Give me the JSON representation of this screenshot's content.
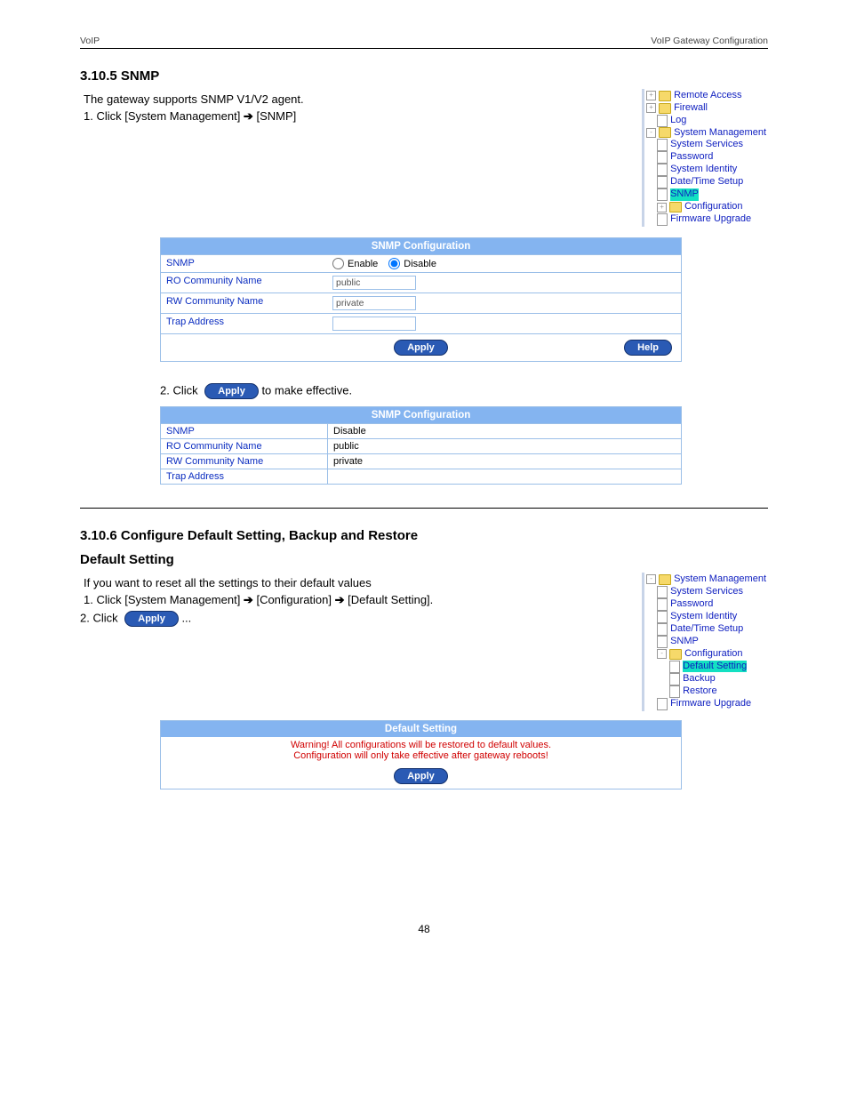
{
  "header": {
    "left": "VoIP",
    "right": "VoIP Gateway Configuration"
  },
  "snmp_section": {
    "title": "3.10.5 SNMP",
    "intro": "The gateway supports SNMP V1/V2 agent.",
    "step1_prefix": "Click [System Management] ",
    "step1_suffix": " [SNMP]",
    "config_title": "SNMP Configuration",
    "rows": {
      "snmp_label": "SNMP",
      "enable_label": "Enable",
      "disable_label": "Disable",
      "ro_label": "RO Community Name",
      "ro_value": "public",
      "rw_label": "RW Community Name",
      "rw_value": "private",
      "trap_label": "Trap Address",
      "trap_value": ""
    },
    "apply_label": "Apply",
    "help_label": "Help",
    "step2_prefix": "Click ",
    "step2_suffix": " to make effective.",
    "result_title": "SNMP Configuration",
    "result_rows": {
      "snmp": "Disable",
      "ro": "public",
      "rw": "private",
      "trap": ""
    },
    "nav": {
      "remote_access": "Remote Access",
      "firewall": "Firewall",
      "log": "Log",
      "sys_mgmt": "System Management",
      "sys_services": "System Services",
      "password": "Password",
      "sys_identity": "System Identity",
      "datetime": "Date/Time Setup",
      "snmp": "SNMP",
      "configuration": "Configuration",
      "firmware": "Firmware Upgrade"
    }
  },
  "cfg_section": {
    "title": "3.10.6 Configure Default Setting, Backup and Restore",
    "sub_title": "Default Setting",
    "intro": "If you want to reset all the settings to their default values",
    "step1a": "Click [System Management] ",
    "step1b": " [Configuration] ",
    "step1c": " [Default Setting].",
    "step2_prefix": "Click ",
    "step2_suffix": "...",
    "apply_label": "Apply",
    "panel_title": "Default Setting",
    "warn1": "Warning! All configurations will be restored to default values.",
    "warn2": "Configuration will only take effective after gateway reboots!",
    "nav": {
      "sys_mgmt": "System Management",
      "sys_services": "System Services",
      "password": "Password",
      "sys_identity": "System Identity",
      "datetime": "Date/Time Setup",
      "snmp": "SNMP",
      "configuration": "Configuration",
      "default_setting": "Default Setting",
      "backup": "Backup",
      "restore": "Restore",
      "firmware": "Firmware Upgrade"
    }
  },
  "page_number": "48"
}
